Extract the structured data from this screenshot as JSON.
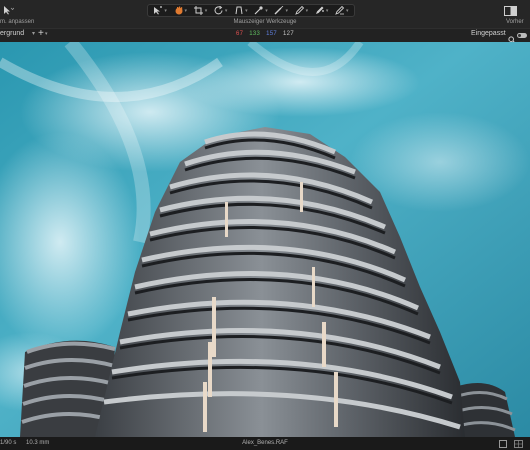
{
  "toolbar": {
    "left_label": "m. anpassen",
    "tools_label": "Mauszeiger Werkzeuge",
    "right_label": "Vorher",
    "tools": [
      "cursor-pan-icon",
      "hand-icon",
      "crop-icon",
      "rotate-icon",
      "keystone-icon",
      "picker-icon",
      "brush-icon",
      "pen-icon",
      "pen-alt-icon",
      "eraser-icon"
    ]
  },
  "subbar": {
    "layer_name": "ergrund",
    "rgb": {
      "r": "67",
      "g": "133",
      "b": "157",
      "l": "127"
    },
    "zoom_label": "Eingepasst"
  },
  "statusbar": {
    "shutter": "1/90 s",
    "focal": "10.3 mm",
    "filename": "Alex_Benes.RAF"
  },
  "colors": {
    "r": "#e05050",
    "g": "#60c060",
    "b": "#6080e0",
    "l": "#c8c8c8"
  }
}
